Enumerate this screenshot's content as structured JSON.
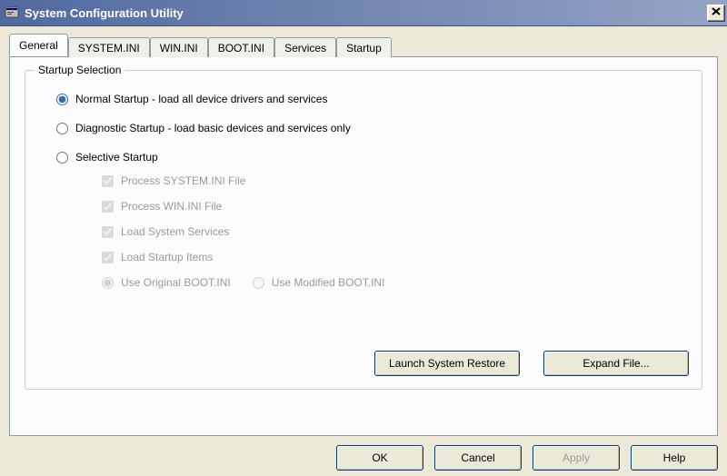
{
  "window": {
    "title": "System Configuration Utility",
    "close_glyph": "✕"
  },
  "tabs": [
    {
      "label": "General"
    },
    {
      "label": "SYSTEM.INI"
    },
    {
      "label": "WIN.INI"
    },
    {
      "label": "BOOT.INI"
    },
    {
      "label": "Services"
    },
    {
      "label": "Startup"
    }
  ],
  "group": {
    "legend": "Startup Selection",
    "radios": {
      "normal": "Normal Startup - load all device drivers and services",
      "diagnostic": "Diagnostic Startup - load basic devices and services only",
      "selective": "Selective Startup"
    },
    "checks": {
      "system_ini": "Process SYSTEM.INI File",
      "win_ini": "Process WIN.INI File",
      "load_services": "Load System Services",
      "load_startup": "Load Startup Items"
    },
    "bootini": {
      "original": "Use Original BOOT.INI",
      "modified": "Use Modified BOOT.INI"
    }
  },
  "group_buttons": {
    "launch_restore": "Launch System Restore",
    "expand_file": "Expand File..."
  },
  "dialog_buttons": {
    "ok": "OK",
    "cancel": "Cancel",
    "apply": "Apply",
    "help": "Help"
  }
}
